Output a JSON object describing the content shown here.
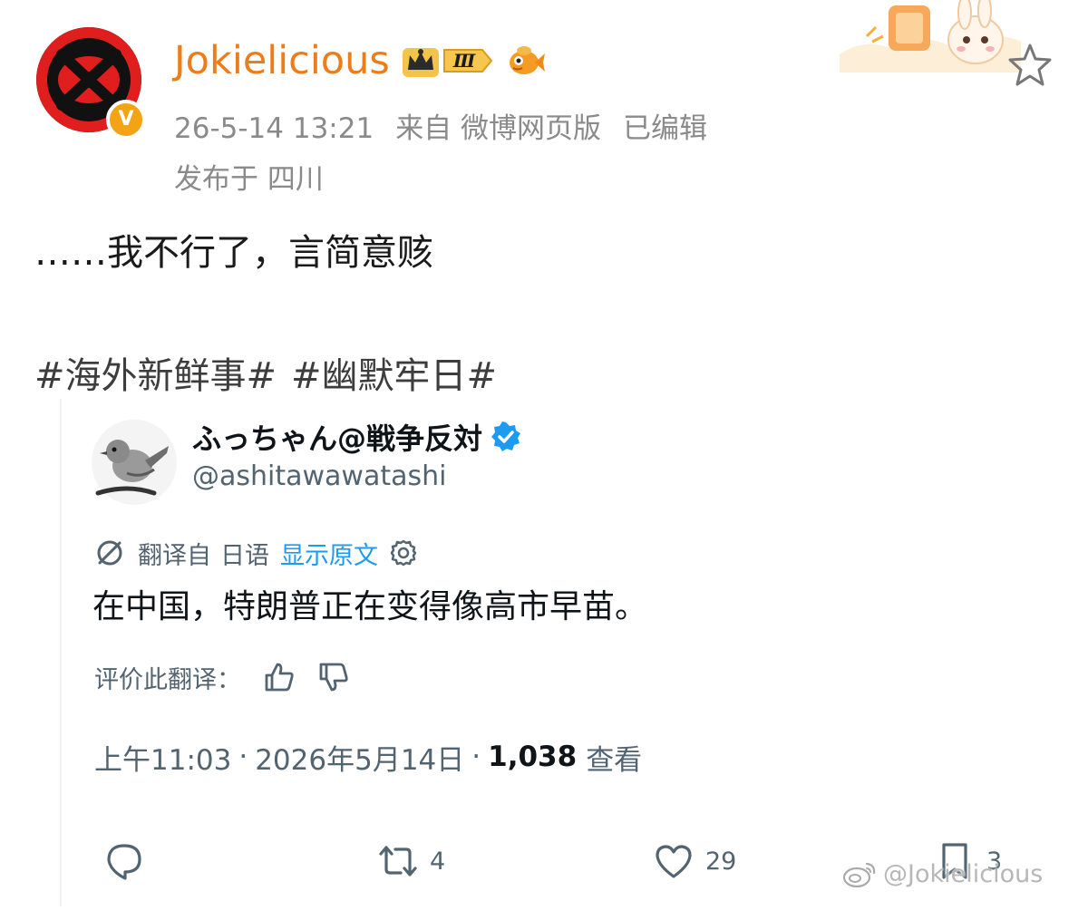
{
  "weibo_post": {
    "username": "Jokielicious",
    "level_badge": "Ⅲ",
    "verified_mark": "V",
    "timestamp": "26-5-14 13:21",
    "source": "来自 微博网页版",
    "edited": "已编辑",
    "location": "发布于 四川",
    "text": "……我不行了，言简意赅",
    "hashtags": [
      "#海外新鲜事#",
      "#幽默牢日#"
    ]
  },
  "tweet": {
    "display_name": "ふっちゃん@戦争反対",
    "handle": "@ashitawawatashi",
    "translated_from": "翻译自",
    "source_language": "日语",
    "show_original": "显示原文",
    "text": "在中国，特朗普正在变得像高市早苗。",
    "rate_translation": "评价此翻译：",
    "time": "上午11:03",
    "date": "2026年5月14日",
    "views_count": "1,038",
    "views_label": "查看",
    "retweet_count": "4",
    "like_count": "29",
    "bookmark_count": "3"
  },
  "watermark": "@Jokielicious",
  "colors": {
    "username": "#ec7d1a",
    "meta_gray": "#8a8a8a",
    "link_blue": "#1d9bf0",
    "tweet_gray": "#536471",
    "verified_blue": "#1d9bf0",
    "badge_orange": "#f4a315"
  },
  "icons": {
    "avatar": "red-black-x-logo",
    "crown": "crown-icon",
    "fish": "goldfish-emoji-icon",
    "star": "star-outline-icon",
    "bunny": "bunny-decoration",
    "translate": "translate-icon",
    "gear": "gear-icon",
    "thumb_up": "thumb-up-icon",
    "thumb_down": "thumb-down-icon",
    "reply": "reply-bubble-icon",
    "retweet": "retweet-icon",
    "like": "heart-icon",
    "bookmark": "bookmark-icon",
    "weibo": "weibo-logo-icon"
  }
}
